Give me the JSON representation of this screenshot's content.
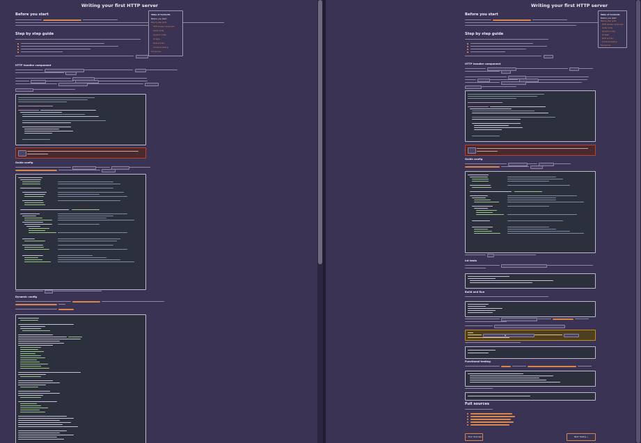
{
  "page_title": "Writing your first HTTP server",
  "sections": {
    "before_you_start": "Before you start",
    "step_by_step": "Step by step guide",
    "http_handler": "HTTP handler component",
    "guide_config": "Guide config",
    "dynamic_config": "Dynamic config",
    "int_tests": "Int tests",
    "build_and_run": "Build and Run",
    "functional_testing": "Functional testing",
    "full_sources": "Full sources"
  },
  "toc": {
    "heading": "Table of Contents",
    "subheading": "Before you start",
    "items": [
      "Step by step guide",
      "HTTP handler component",
      "Guide config",
      "Dynamic config",
      "Int tests",
      "Build and Run",
      "Functional testing",
      "Full sources"
    ]
  },
  "nav": {
    "prev_label": "← Prev: Overview",
    "next_label": "Next: Testing →"
  },
  "colors": {
    "background": "#3a3354",
    "link": "#d9874a",
    "code_bg": "#2c303d",
    "warning_border": "#b6452f",
    "note_border": "#c78a1f"
  }
}
